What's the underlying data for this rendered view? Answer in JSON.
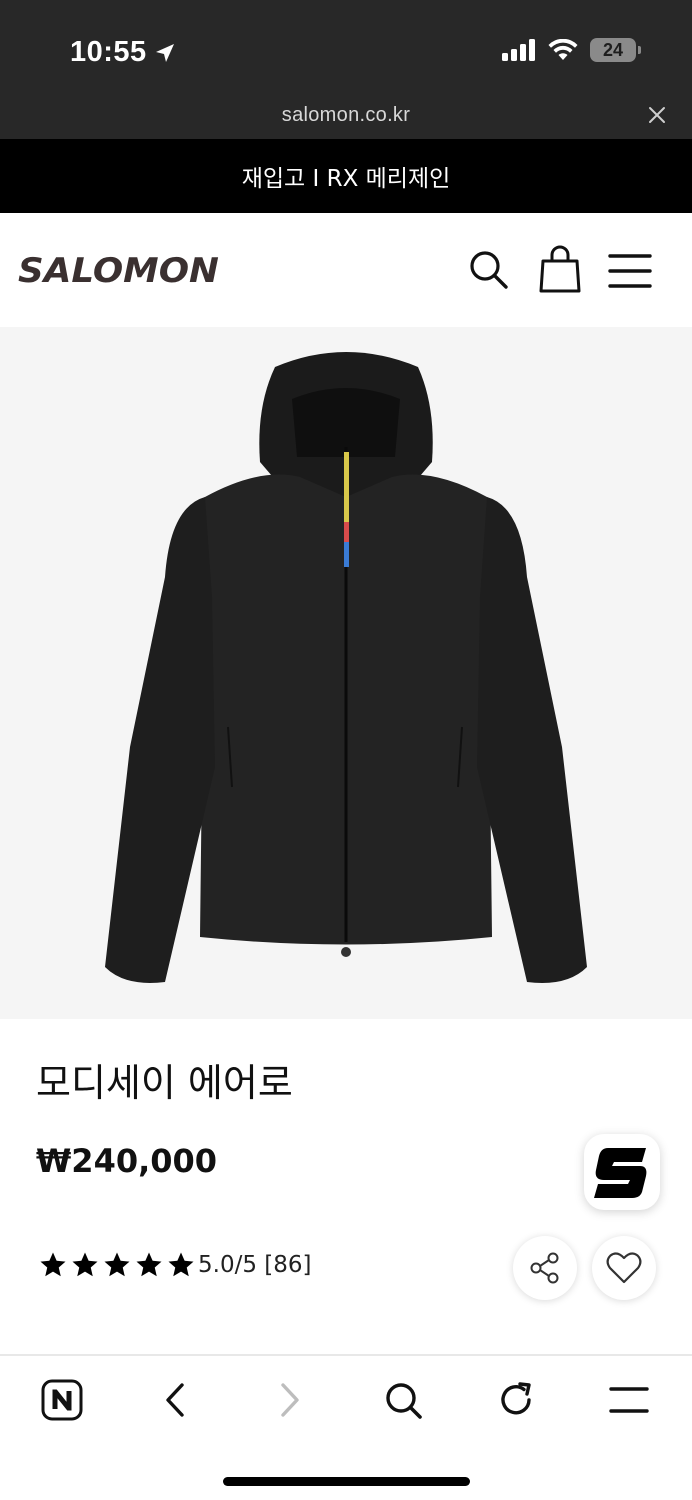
{
  "status_bar": {
    "time": "10:55",
    "battery": "24",
    "icons": [
      "location-arrow-icon",
      "signal-icon",
      "wifi-icon",
      "battery-icon"
    ]
  },
  "browser": {
    "url": "salomon.co.kr"
  },
  "promo_banner": {
    "text": "재입고 I RX 메리제인"
  },
  "header": {
    "logo": "SALOMON",
    "icons": [
      "search-icon",
      "shopping-bag-icon",
      "menu-icon"
    ]
  },
  "product": {
    "image": "black-hooded-jacket",
    "name": "모디세이 에어로",
    "price": "₩240,000",
    "rating_stars": 5,
    "rating_text": "5.0/5 [86]"
  },
  "floating_badge": {
    "icon": "salomon-s-logo-icon"
  },
  "actions": {
    "icons": [
      "share-icon",
      "heart-icon"
    ]
  },
  "toolbar": {
    "icons": [
      "naver-home-icon",
      "back-icon",
      "forward-icon",
      "search-icon",
      "reload-icon",
      "menu-icon"
    ]
  },
  "colors": {
    "status_bg": "#282828",
    "banner_bg": "#000000",
    "image_bg": "#f5f5f5",
    "logo": "#3a3030"
  }
}
